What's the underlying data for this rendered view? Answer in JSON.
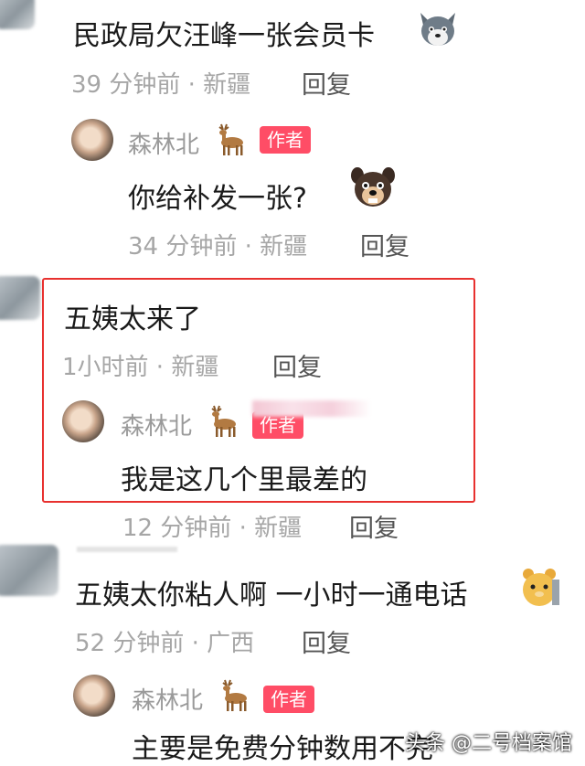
{
  "comments": [
    {
      "text": "民政局欠汪峰一张会员卡",
      "meta": "39 分钟前 · 新疆",
      "reply": "回复",
      "emoji": "wolf-dog-emoji"
    },
    {
      "text": "你给补发一张?",
      "meta": "34 分钟前 · 新疆",
      "reply": "回复",
      "author": "森林北",
      "badge": "作者",
      "emoji": "dog-emoji"
    },
    {
      "text": "五姨太来了",
      "meta": "1小时前 · 新疆",
      "reply": "回复"
    },
    {
      "text": "我是这几个里最差的",
      "meta": "12 分钟前 · 新疆",
      "reply": "回复",
      "author": "森林北",
      "badge": "作者"
    },
    {
      "text": "五姨太你粘人啊 一小时一通电话",
      "meta": "52 分钟前 · 广西",
      "reply": "回复",
      "emoji": "hamster-emoji"
    },
    {
      "text": "主要是免费分钟数用不完",
      "author": "森林北",
      "badge": "作者"
    }
  ],
  "watermark": "头条 @二号档案馆",
  "colors": {
    "badge": "#ff4d66",
    "highlight": "#e8312f",
    "meta": "#a6a6a6"
  }
}
